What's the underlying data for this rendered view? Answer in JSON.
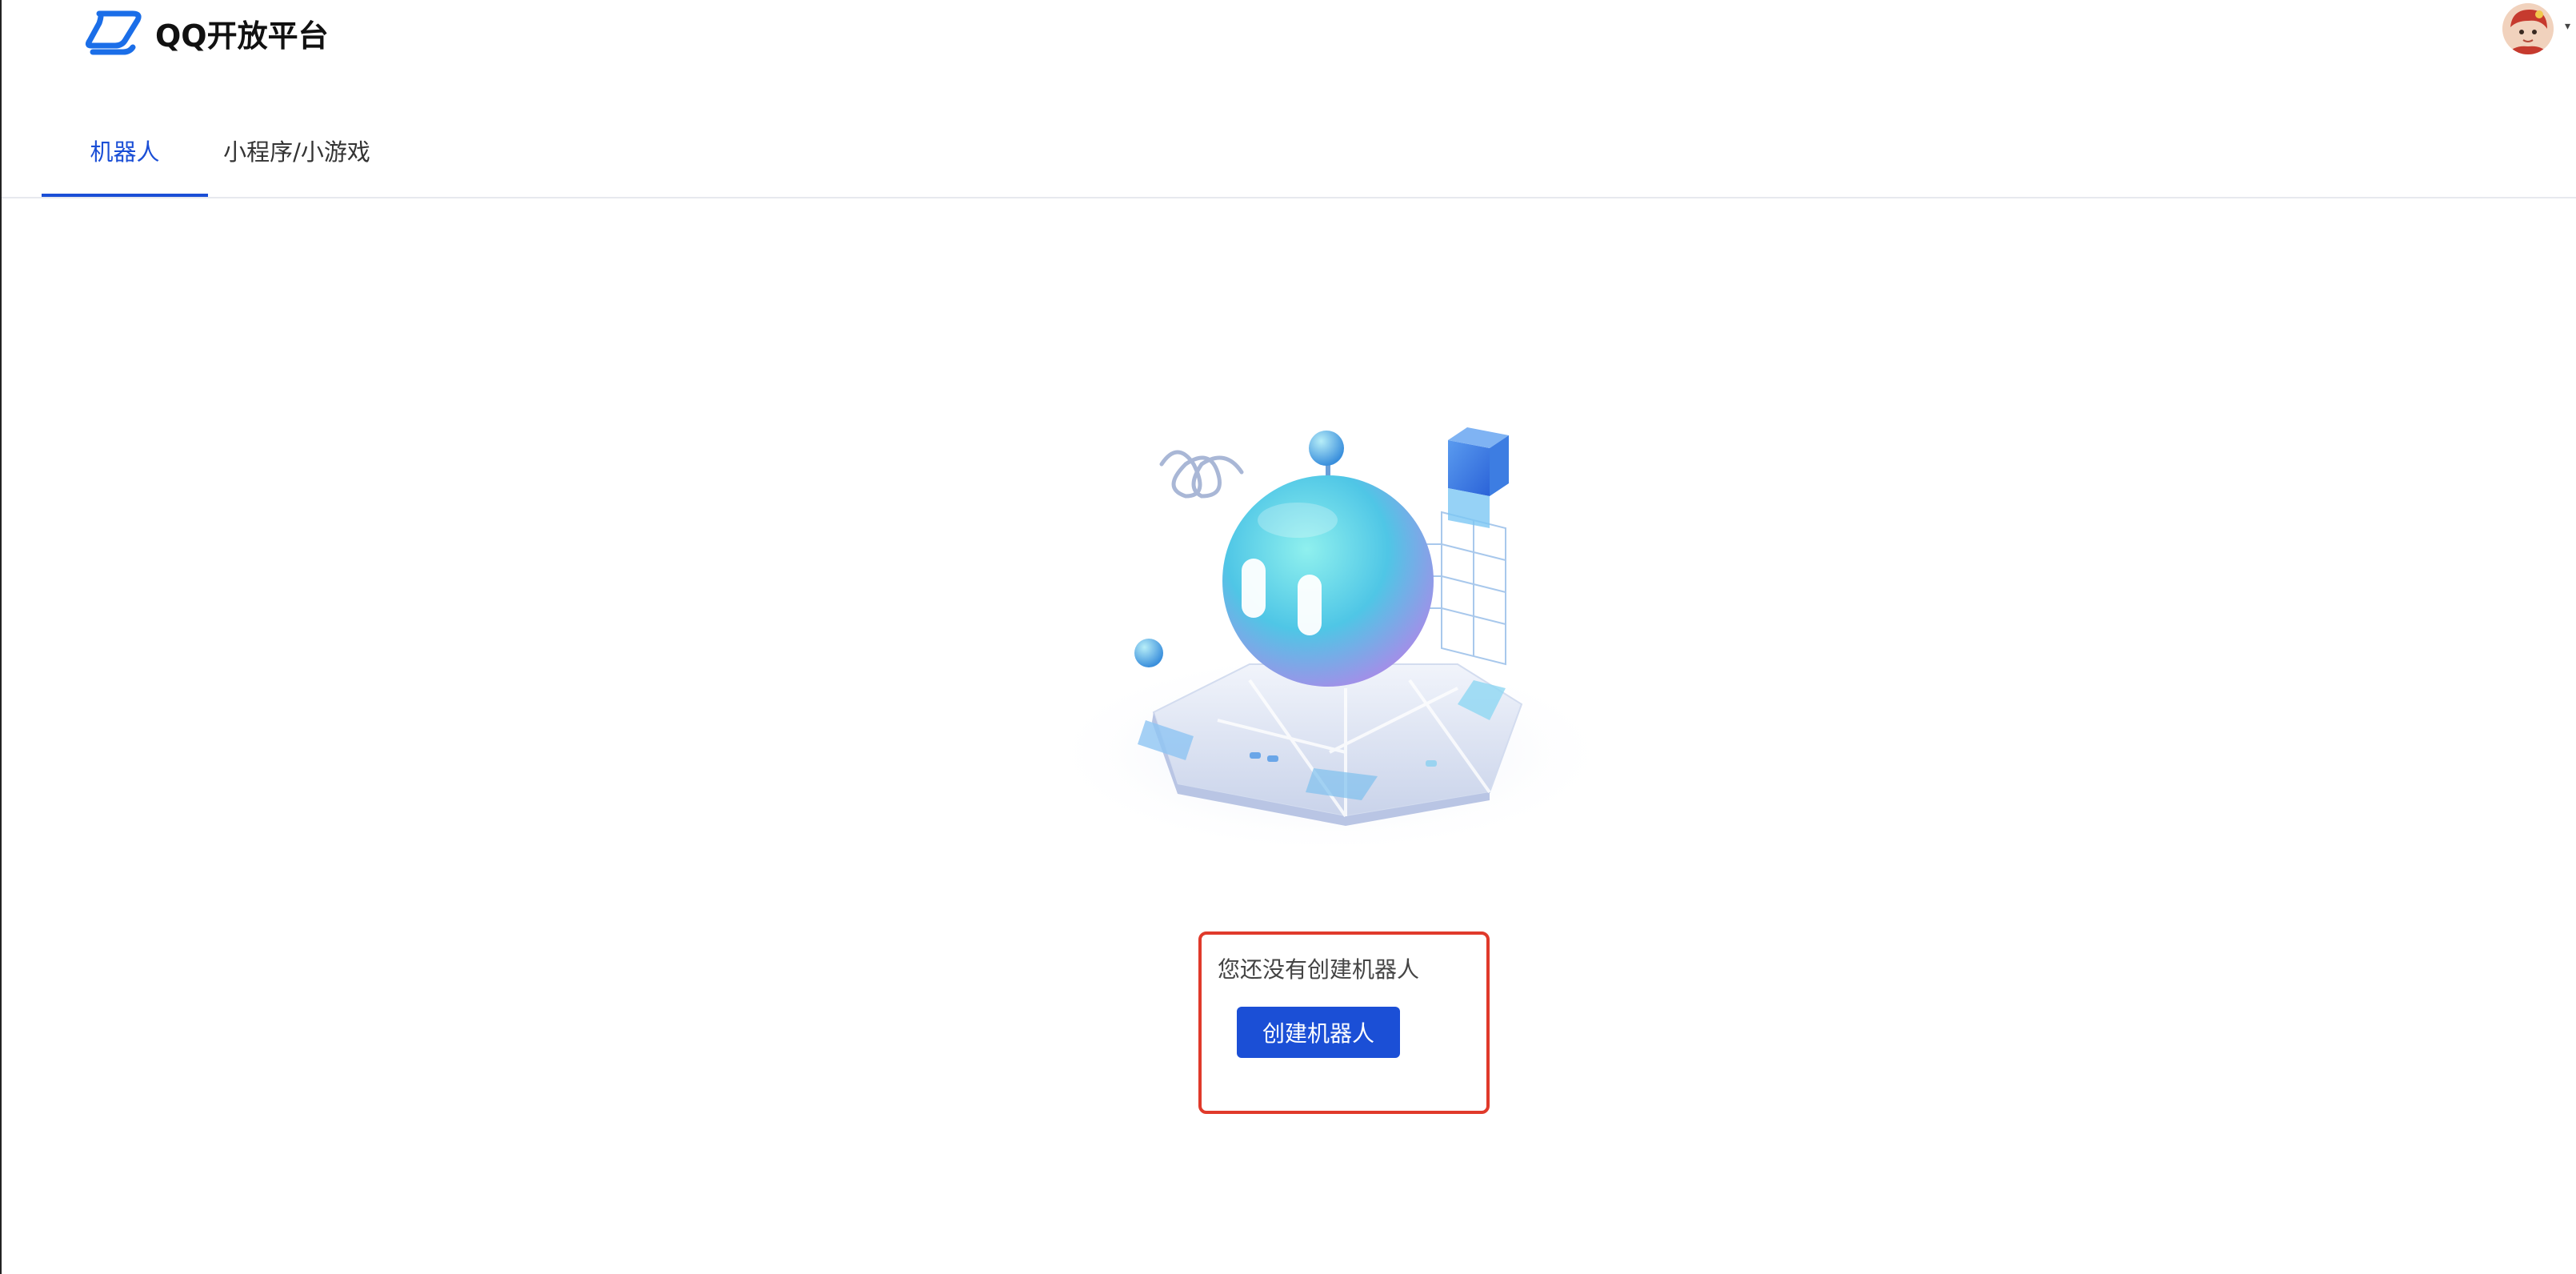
{
  "header": {
    "logo_text": "QQ开放平台",
    "logo_icon": "qq-open-platform-logo",
    "avatar_icon": "user-avatar",
    "avatar_caret_icon": "chevron-down-icon"
  },
  "tabs": [
    {
      "label": "机器人",
      "active": true
    },
    {
      "label": "小程序/小游戏",
      "active": false
    }
  ],
  "empty_state": {
    "message": "您还没有创建机器人",
    "button_label": "创建机器人",
    "illustration_icon": "robot-illustration"
  },
  "colors": {
    "accent": "#1b4fd6",
    "highlight_border": "#e03a2b",
    "tab_divider": "#e7e9ee"
  }
}
